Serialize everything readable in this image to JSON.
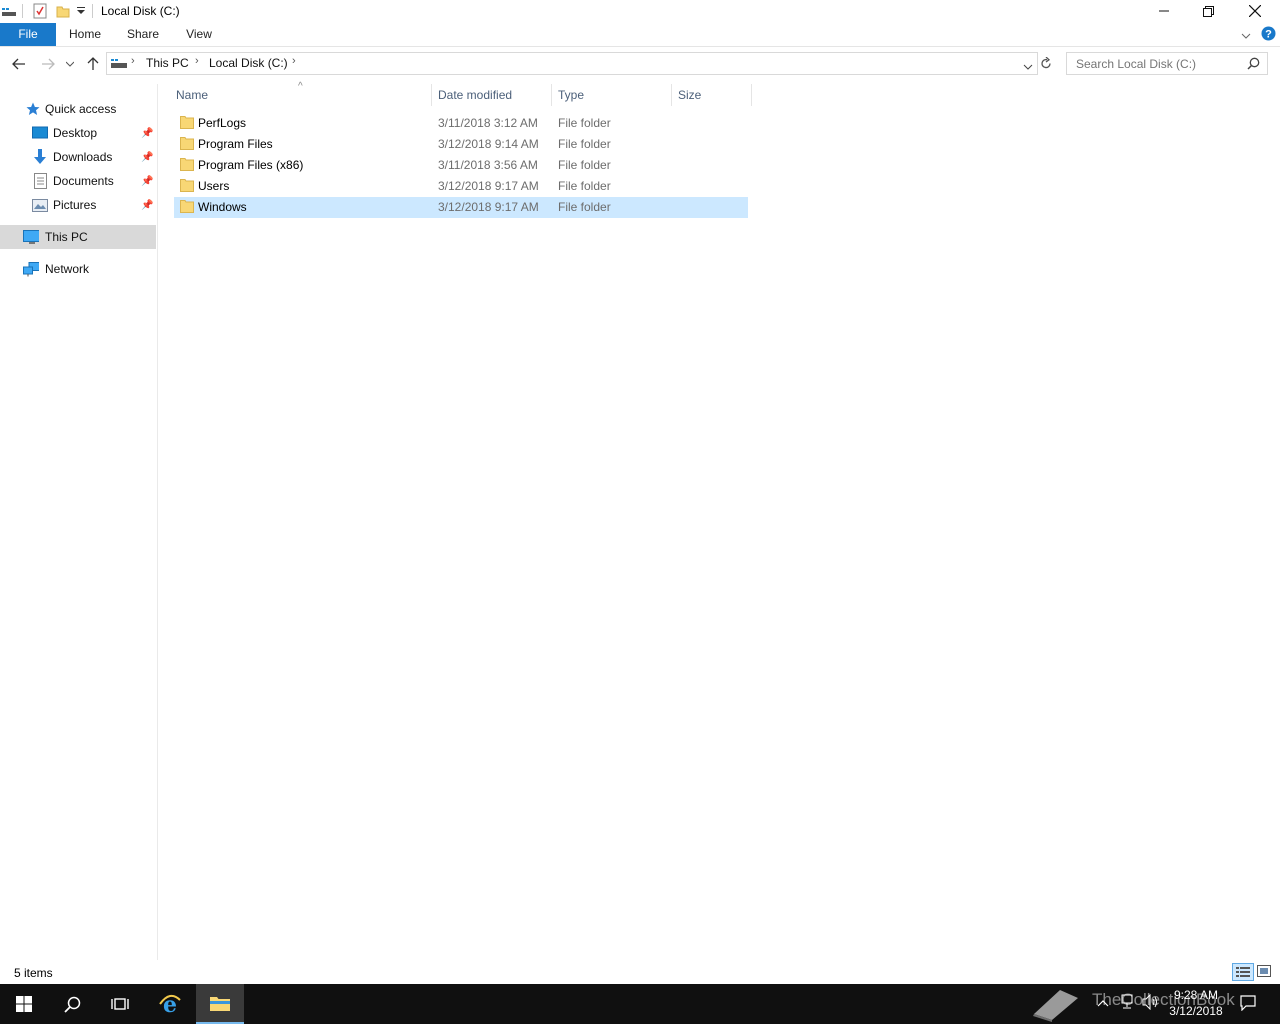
{
  "window": {
    "title": "Local Disk (C:)",
    "qat_dropdown_icon": "chevron-down-icon"
  },
  "ribbon": {
    "tabs": [
      {
        "label": "File"
      },
      {
        "label": "Home"
      },
      {
        "label": "Share"
      },
      {
        "label": "View"
      }
    ]
  },
  "address": {
    "crumbs": [
      "This PC",
      "Local Disk (C:)"
    ],
    "search_placeholder": "Search Local Disk (C:)"
  },
  "nav": {
    "quick_access": "Quick access",
    "items": [
      {
        "label": "Desktop",
        "pinned": true
      },
      {
        "label": "Downloads",
        "pinned": true
      },
      {
        "label": "Documents",
        "pinned": true
      },
      {
        "label": "Pictures",
        "pinned": true
      }
    ],
    "this_pc": "This PC",
    "network": "Network"
  },
  "columns": {
    "name": "Name",
    "date": "Date modified",
    "type": "Type",
    "size": "Size",
    "sort_indicator": "^"
  },
  "files": [
    {
      "name": "PerfLogs",
      "date": "3/11/2018 3:12 AM",
      "type": "File folder",
      "size": ""
    },
    {
      "name": "Program Files",
      "date": "3/12/2018 9:14 AM",
      "type": "File folder",
      "size": ""
    },
    {
      "name": "Program Files (x86)",
      "date": "3/11/2018 3:56 AM",
      "type": "File folder",
      "size": ""
    },
    {
      "name": "Users",
      "date": "3/12/2018 9:17 AM",
      "type": "File folder",
      "size": ""
    },
    {
      "name": "Windows",
      "date": "3/12/2018 9:17 AM",
      "type": "File folder",
      "size": "",
      "selected": true
    }
  ],
  "status": {
    "item_count": "5 items"
  },
  "taskbar": {
    "time": "9:28 AM",
    "date": "3/12/2018",
    "watermark": "TheCollectionBook"
  },
  "colors": {
    "accent": "#1979ca",
    "selection": "#cce8ff",
    "taskbar": "#101010",
    "folder": "#f8d775"
  }
}
